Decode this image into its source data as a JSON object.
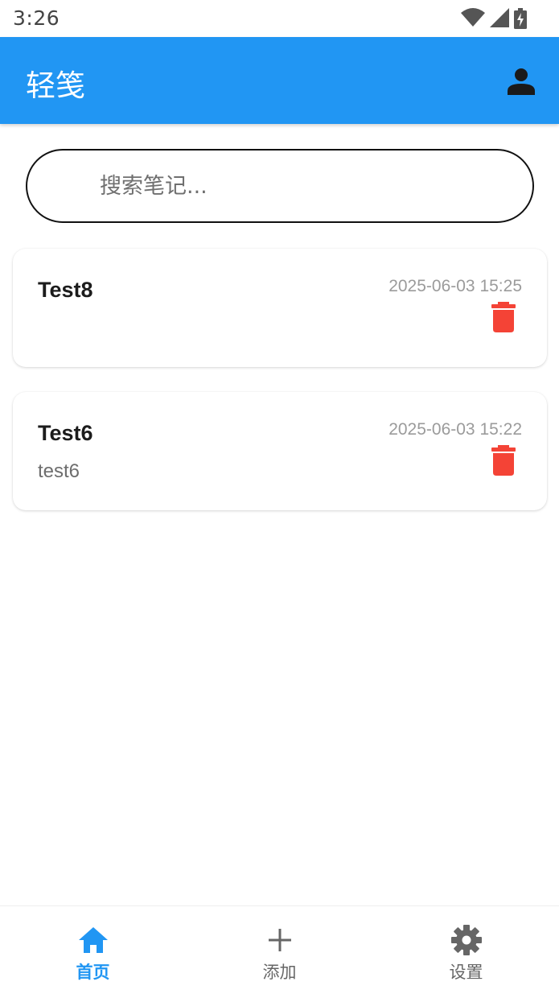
{
  "status_bar": {
    "time": "3:26"
  },
  "app_bar": {
    "title": "轻笺"
  },
  "search": {
    "placeholder": "搜索笔记..."
  },
  "notes": [
    {
      "title": "Test8",
      "timestamp": "2025-06-03 15:25",
      "body": ""
    },
    {
      "title": "Test6",
      "timestamp": "2025-06-03 15:22",
      "body": "test6"
    }
  ],
  "bottom_nav": {
    "items": [
      {
        "label": "首页",
        "icon": "home-icon",
        "active": true
      },
      {
        "label": "添加",
        "icon": "plus-icon",
        "active": false
      },
      {
        "label": "设置",
        "icon": "gear-icon",
        "active": false
      }
    ]
  },
  "colors": {
    "primary": "#2196f3",
    "delete": "#f44336",
    "inactive": "#666666"
  }
}
